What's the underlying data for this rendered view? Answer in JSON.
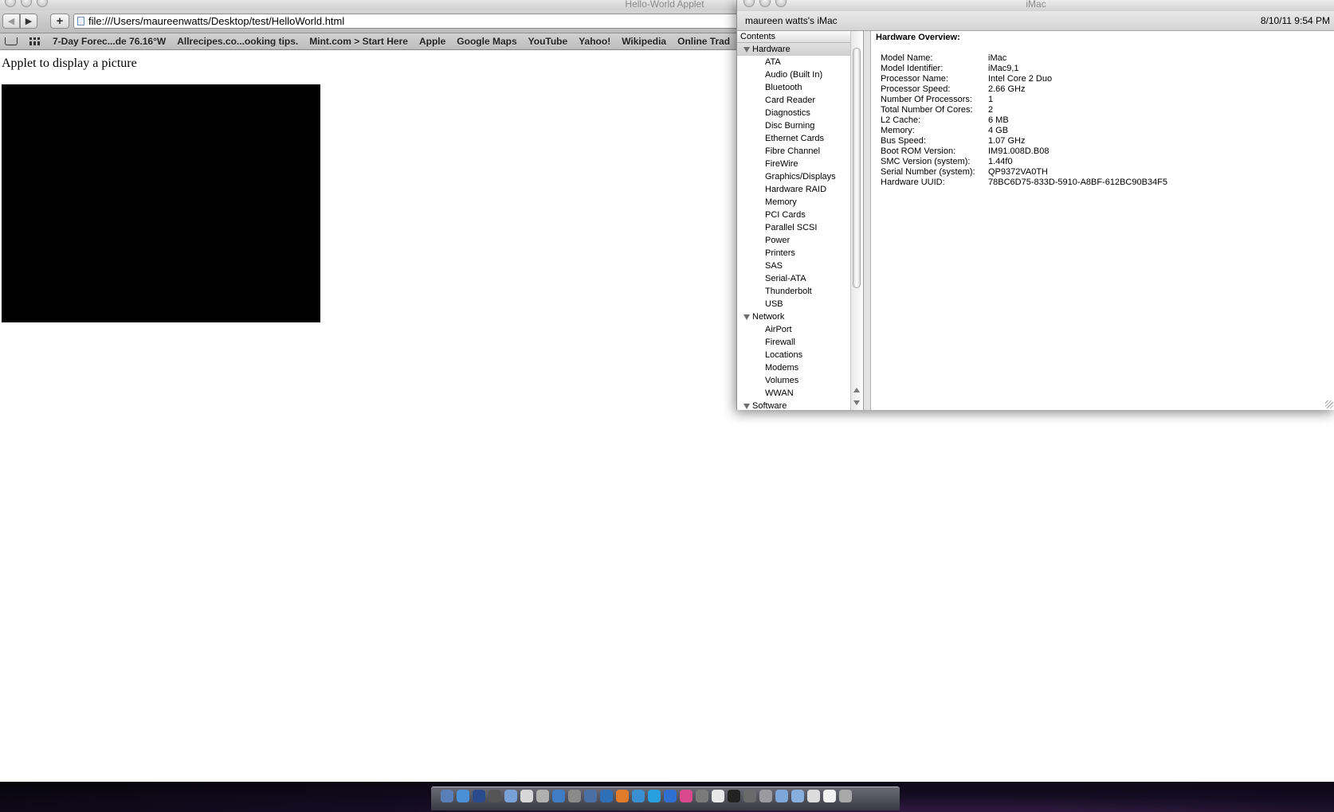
{
  "browser": {
    "window_title": "Hello-World Applet",
    "url": "file:///Users/maureenwatts/Desktop/test/HelloWorld.html",
    "bookmarks": [
      "7-Day Forec...de 76.16°W",
      "Allrecipes.co...ooking tips.",
      "Mint.com > Start Here",
      "Apple",
      "Google Maps",
      "YouTube",
      "Yahoo!",
      "Wikipedia",
      "Online Trad"
    ],
    "page_heading": "Applet to display a picture"
  },
  "profiler": {
    "window_title": "iMac",
    "machine_name": "maureen watts's iMac",
    "report_time": "8/10/11 9:54 PM",
    "sidebar_header": "Contents",
    "categories": [
      {
        "label": "Hardware",
        "expanded": true,
        "selected": true,
        "items": [
          "ATA",
          "Audio (Built In)",
          "Bluetooth",
          "Card Reader",
          "Diagnostics",
          "Disc Burning",
          "Ethernet Cards",
          "Fibre Channel",
          "FireWire",
          "Graphics/Displays",
          "Hardware RAID",
          "Memory",
          "PCI Cards",
          "Parallel SCSI",
          "Power",
          "Printers",
          "SAS",
          "Serial-ATA",
          "Thunderbolt",
          "USB"
        ]
      },
      {
        "label": "Network",
        "expanded": true,
        "selected": false,
        "items": [
          "AirPort",
          "Firewall",
          "Locations",
          "Modems",
          "Volumes",
          "WWAN"
        ]
      },
      {
        "label": "Software",
        "expanded": true,
        "selected": false,
        "items": []
      }
    ],
    "detail_title": "Hardware Overview:",
    "overview": [
      {
        "key": "Model Name:",
        "value": "iMac"
      },
      {
        "key": "Model Identifier:",
        "value": "iMac9,1"
      },
      {
        "key": "Processor Name:",
        "value": "Intel Core 2 Duo"
      },
      {
        "key": "Processor Speed:",
        "value": "2.66 GHz"
      },
      {
        "key": "Number Of Processors:",
        "value": "1"
      },
      {
        "key": "Total Number Of Cores:",
        "value": "2"
      },
      {
        "key": "L2 Cache:",
        "value": "6 MB"
      },
      {
        "key": "Memory:",
        "value": "4 GB"
      },
      {
        "key": "Bus Speed:",
        "value": "1.07 GHz"
      },
      {
        "key": "Boot ROM Version:",
        "value": "IM91.008D.B08"
      },
      {
        "key": "SMC Version (system):",
        "value": "1.44f0"
      },
      {
        "key": "Serial Number (system):",
        "value": "QP9372VA0TH"
      },
      {
        "key": "Hardware UUID:",
        "value": "78BC6D75-833D-5910-A8BF-612BC90B34F5"
      }
    ]
  },
  "dock": {
    "icons": [
      "finder-icon",
      "safari-icon",
      "photoshop-icon",
      "dashboard-icon",
      "app-store-icon",
      "ical-icon",
      "preview-icon",
      "itunes-icon",
      "system-preferences-icon",
      "mail-icon",
      "google-earth-icon",
      "firefox-icon",
      "chrome-icon",
      "skype-icon",
      "internet-explorer-icon",
      "photo-booth-icon",
      "time-machine-icon",
      "textedit-icon",
      "terminal-icon",
      "script-editor-icon",
      "utility-icon",
      "applications-folder-icon",
      "documents-folder-icon",
      "downloads-stack-icon",
      "preview-document-icon",
      "trash-icon"
    ],
    "colors": [
      "#5a7fb8",
      "#4b8fd6",
      "#2a4a8c",
      "#555555",
      "#7aa0d8",
      "#d7d7d7",
      "#b0b0b0",
      "#3f7cc4",
      "#8a8a8a",
      "#4a6fa5",
      "#2f6fb5",
      "#e07b2a",
      "#3a8fd0",
      "#28a0e0",
      "#2f6fd0",
      "#d94a8c",
      "#7a7a7a",
      "#e8e8e8",
      "#222222",
      "#6a6a6a",
      "#9a9aa0",
      "#7fa6d8",
      "#88aede",
      "#dcdcdc",
      "#f2f2f2",
      "#a8a8a8"
    ]
  }
}
